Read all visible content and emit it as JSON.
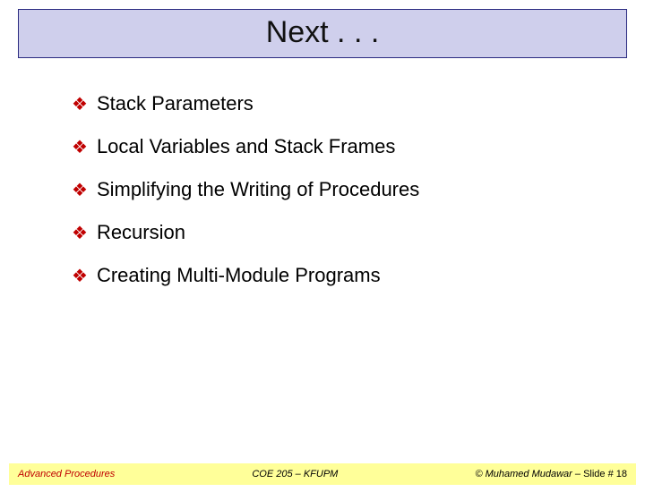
{
  "title": "Next . . .",
  "items": [
    {
      "text": "Stack Parameters"
    },
    {
      "text": "Local Variables and Stack Frames"
    },
    {
      "text": "Simplifying the Writing of Procedures"
    },
    {
      "text": "Recursion"
    },
    {
      "text": "Creating Multi-Module Programs"
    }
  ],
  "footer": {
    "left": "Advanced Procedures",
    "center": "COE 205 – KFUPM",
    "right_author": "© Muhamed Mudawar",
    "right_sep": " – ",
    "right_slide": "Slide # 18"
  },
  "bullet_glyph": "❖"
}
